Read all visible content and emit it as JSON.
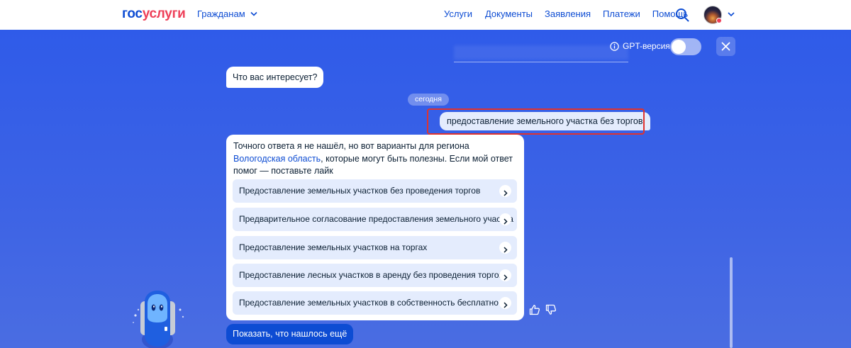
{
  "header": {
    "logo_part1": "гос",
    "logo_part2": "услуги",
    "audience_label": "Гражданам",
    "nav": [
      "Услуги",
      "Документы",
      "Заявления",
      "Платежи",
      "Помощь"
    ]
  },
  "chat": {
    "gpt_label": "GPT-версия",
    "gpt_toggle_on": false,
    "bot_question": "Что вас интересует?",
    "date_chip": "сегодня",
    "user_message": "предоставление земельного участка без торгов",
    "answer": {
      "text_before": "Точного ответа я не нашёл, но вот варианты для региона ",
      "region_link": "Вологодская область",
      "text_after": ", которые могут быть полезны. Если мой ответ помог — поставьте лайк",
      "options": [
        "Предоставление земельных участков без проведения торгов",
        "Предварительное согласование предоставления земельного участка",
        "Предоставление земельных участков на торгах",
        "Предоставление лесных участков в аренду без проведения торгов",
        "Предоставление земельных участков в собственность бесплатно"
      ]
    },
    "show_more_label": "Показать, что нашлось ещё"
  },
  "colors": {
    "brand_blue": "#0d4cd3",
    "brand_red": "#ee3f58",
    "highlight_red": "#e0332f",
    "chat_bg": "#2f5be9"
  },
  "icons": [
    "chevron-down-icon",
    "search-icon",
    "info-icon",
    "close-icon",
    "chevron-right-icon",
    "thumbs-up-icon",
    "thumbs-down-icon"
  ]
}
